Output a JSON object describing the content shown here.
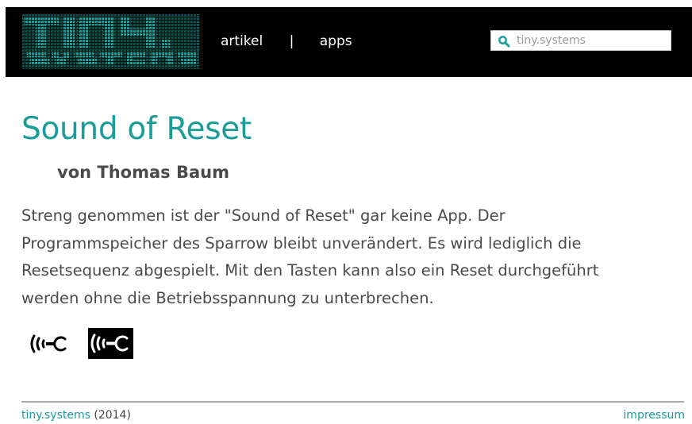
{
  "header": {
    "logo_text": "TINY.SYSTEMS",
    "nav": {
      "articles_label": "artikel",
      "separator": "|",
      "apps_label": "apps"
    },
    "search": {
      "placeholder": "tiny.systems",
      "value": ""
    }
  },
  "article": {
    "title": "Sound of Reset",
    "author": "von Thomas Baum",
    "body": "Streng genommen ist der \"Sound of Reset\" gar keine App. Der Programmspeicher des Sparrow bleibt unverändert. Es wird lediglich die Resetsequenz abgespielt. Mit den Tasten kann also ein Reset durchgeführt werden ohne die Betriebsspannung zu unterbrechen."
  },
  "icons": {
    "reset_sound_icon": "sound-reset-icon",
    "reset_sound_icon_inverted": "sound-reset-icon-boxed"
  },
  "footer": {
    "site_link": "tiny.systems",
    "year": "(2014)",
    "impressum_label": "impressum"
  },
  "colors": {
    "accent": "#1a9c98",
    "header_bg": "#000000",
    "text": "#4a4a4a"
  }
}
